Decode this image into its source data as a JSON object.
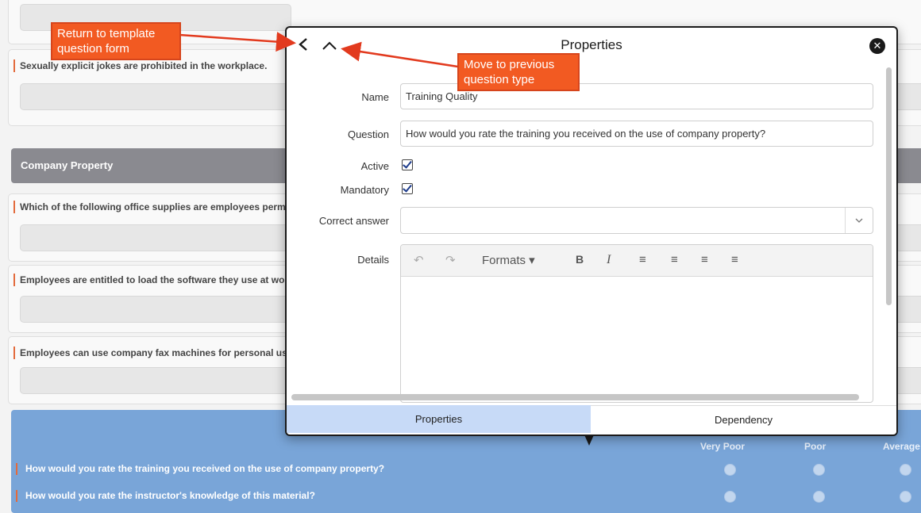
{
  "background_form": {
    "questions_top": [
      "Sexually explicit jokes are prohibited in the workplace."
    ],
    "section_title": "Company Property",
    "questions": [
      "Which of the following office supplies are employees permitted to take home for personal use?",
      "Employees are entitled to load the software they use at work onto their home computers.",
      "Employees can use company fax machines for personal use."
    ],
    "rating": {
      "columns": [
        "Very Poor",
        "Poor",
        "Average"
      ],
      "questions": [
        "How would you rate the training you received on the use of company property?",
        "How would you rate the instructor's knowledge of this material?"
      ]
    }
  },
  "modal": {
    "title": "Properties",
    "back_icon": "chevron-left-icon",
    "up_icon": "chevron-up-icon",
    "close_icon": "close-icon",
    "fields": {
      "name_label": "Name",
      "name_value": "Training Quality",
      "question_label": "Question",
      "question_value": "How would you rate the training you received on the use of company property?",
      "active_label": "Active",
      "mandatory_label": "Mandatory",
      "correct_answer_label": "Correct answer",
      "correct_answer_value": "",
      "details_label": "Details"
    },
    "toolbar": {
      "undo": "↶",
      "redo": "↷",
      "formats": "Formats ▾",
      "bold": "B",
      "italic": "I",
      "align_left": "≡",
      "align_center": "≡",
      "align_right": "≡",
      "justify": "≡"
    },
    "tabs": [
      "Properties",
      "Dependency"
    ],
    "active_tab": "Properties"
  },
  "callouts": {
    "return": "Return to template question form",
    "move": "Move to previous question type"
  },
  "colors": {
    "callout": "#f25a22",
    "rating_panel": "#79a5d8",
    "active_tab": "#c7daf7",
    "section_bar": "#8a8a90"
  }
}
